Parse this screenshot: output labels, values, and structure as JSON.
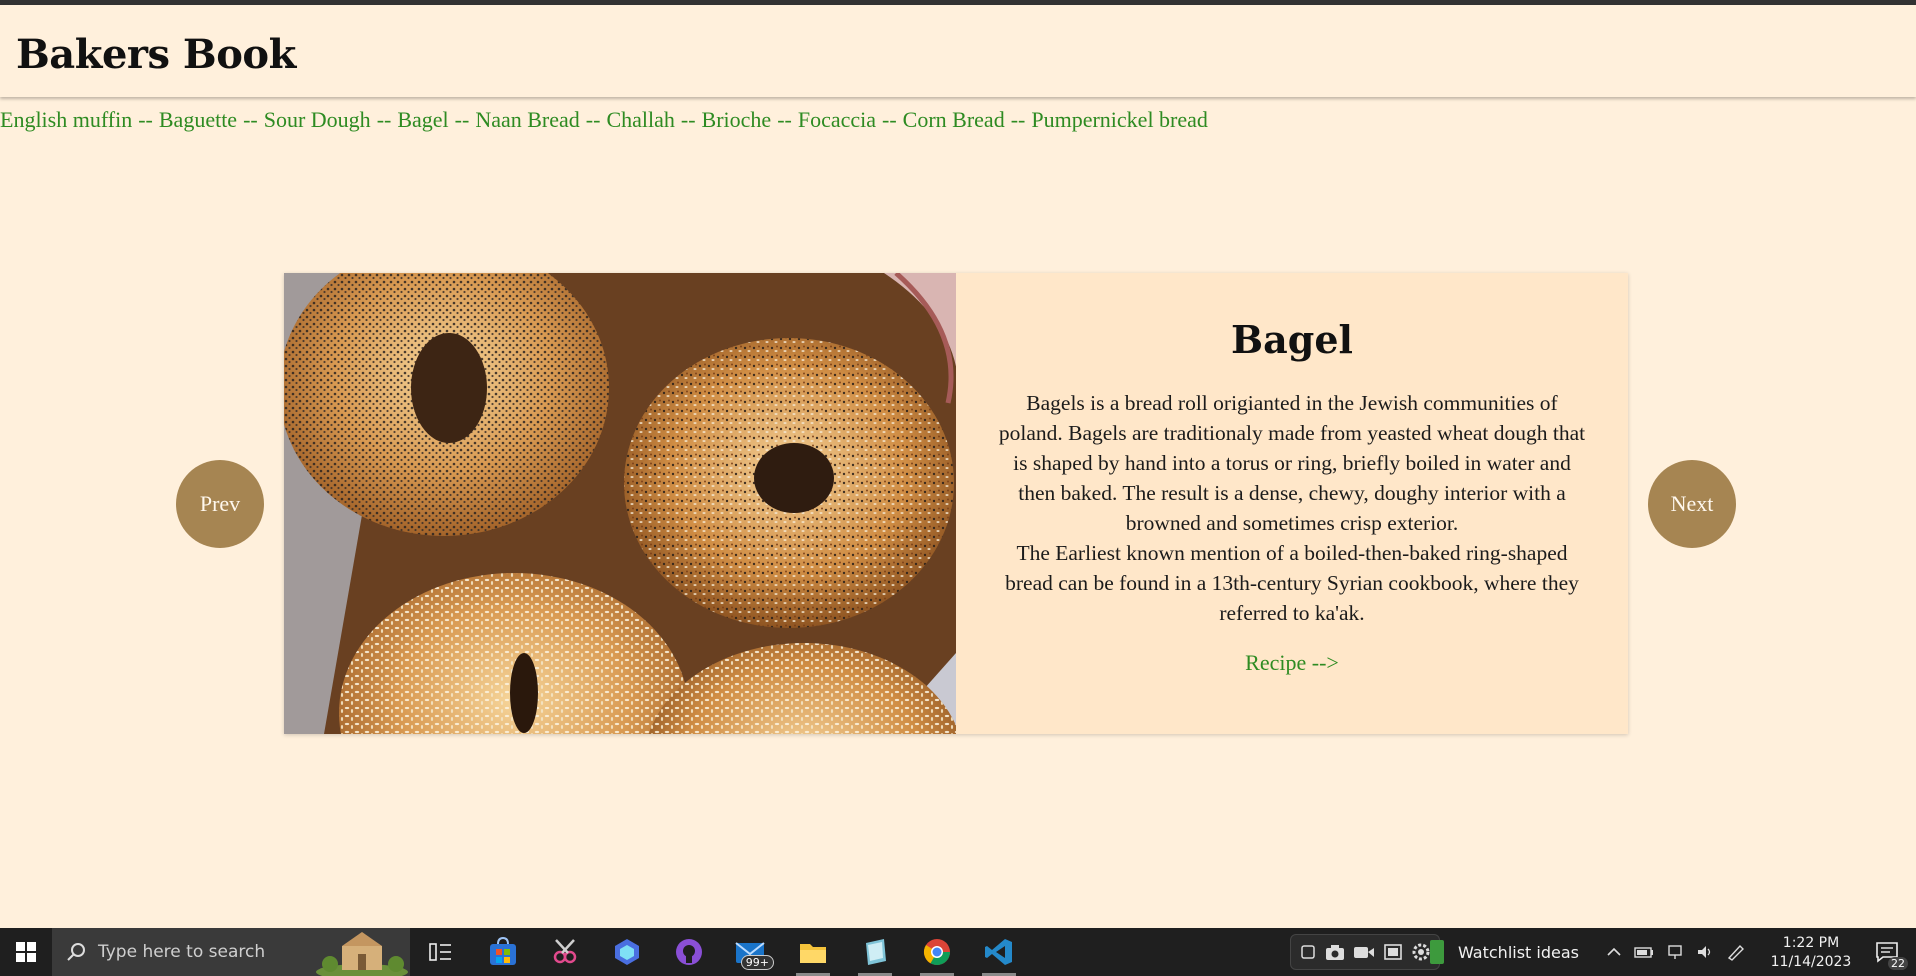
{
  "site": {
    "title": "Bakers Book"
  },
  "marquee": {
    "items": [
      "English muffin",
      "Baguette",
      "Sour Dough",
      "Bagel",
      "Naan Bread",
      "Challah",
      "Brioche",
      "Focaccia",
      "Corn Bread",
      "Pumpernickel bread"
    ],
    "separator": "--"
  },
  "carousel": {
    "prev_label": "Prev",
    "next_label": "Next",
    "card": {
      "title": "Bagel",
      "paragraph1": "Bagels is a bread roll origianted in the Jewish communities of poland. Bagels are traditionaly made from yeasted wheat dough that is shaped by hand into a torus or ring, briefly boiled in water and then baked. The result is a dense, chewy, doughy interior with a browned and sometimes crisp exterior.",
      "paragraph2": "The Earliest known mention of a boiled-then-baked ring-shaped bread can be found in a 13th-century Syrian cookbook, where they referred to ka'ak.",
      "recipe_link": "Recipe -->"
    }
  },
  "taskbar": {
    "search_placeholder": "Type here to search",
    "mail_badge": "99+",
    "watchlist_label": "Watchlist ideas",
    "time": "1:22 PM",
    "date": "11/14/2023",
    "notification_count": "22"
  },
  "colors": {
    "page_bg": "#fff0dc",
    "card_bg": "#ffe7c9",
    "accent_green": "#2e8b22",
    "button_brown": "#a68552"
  }
}
